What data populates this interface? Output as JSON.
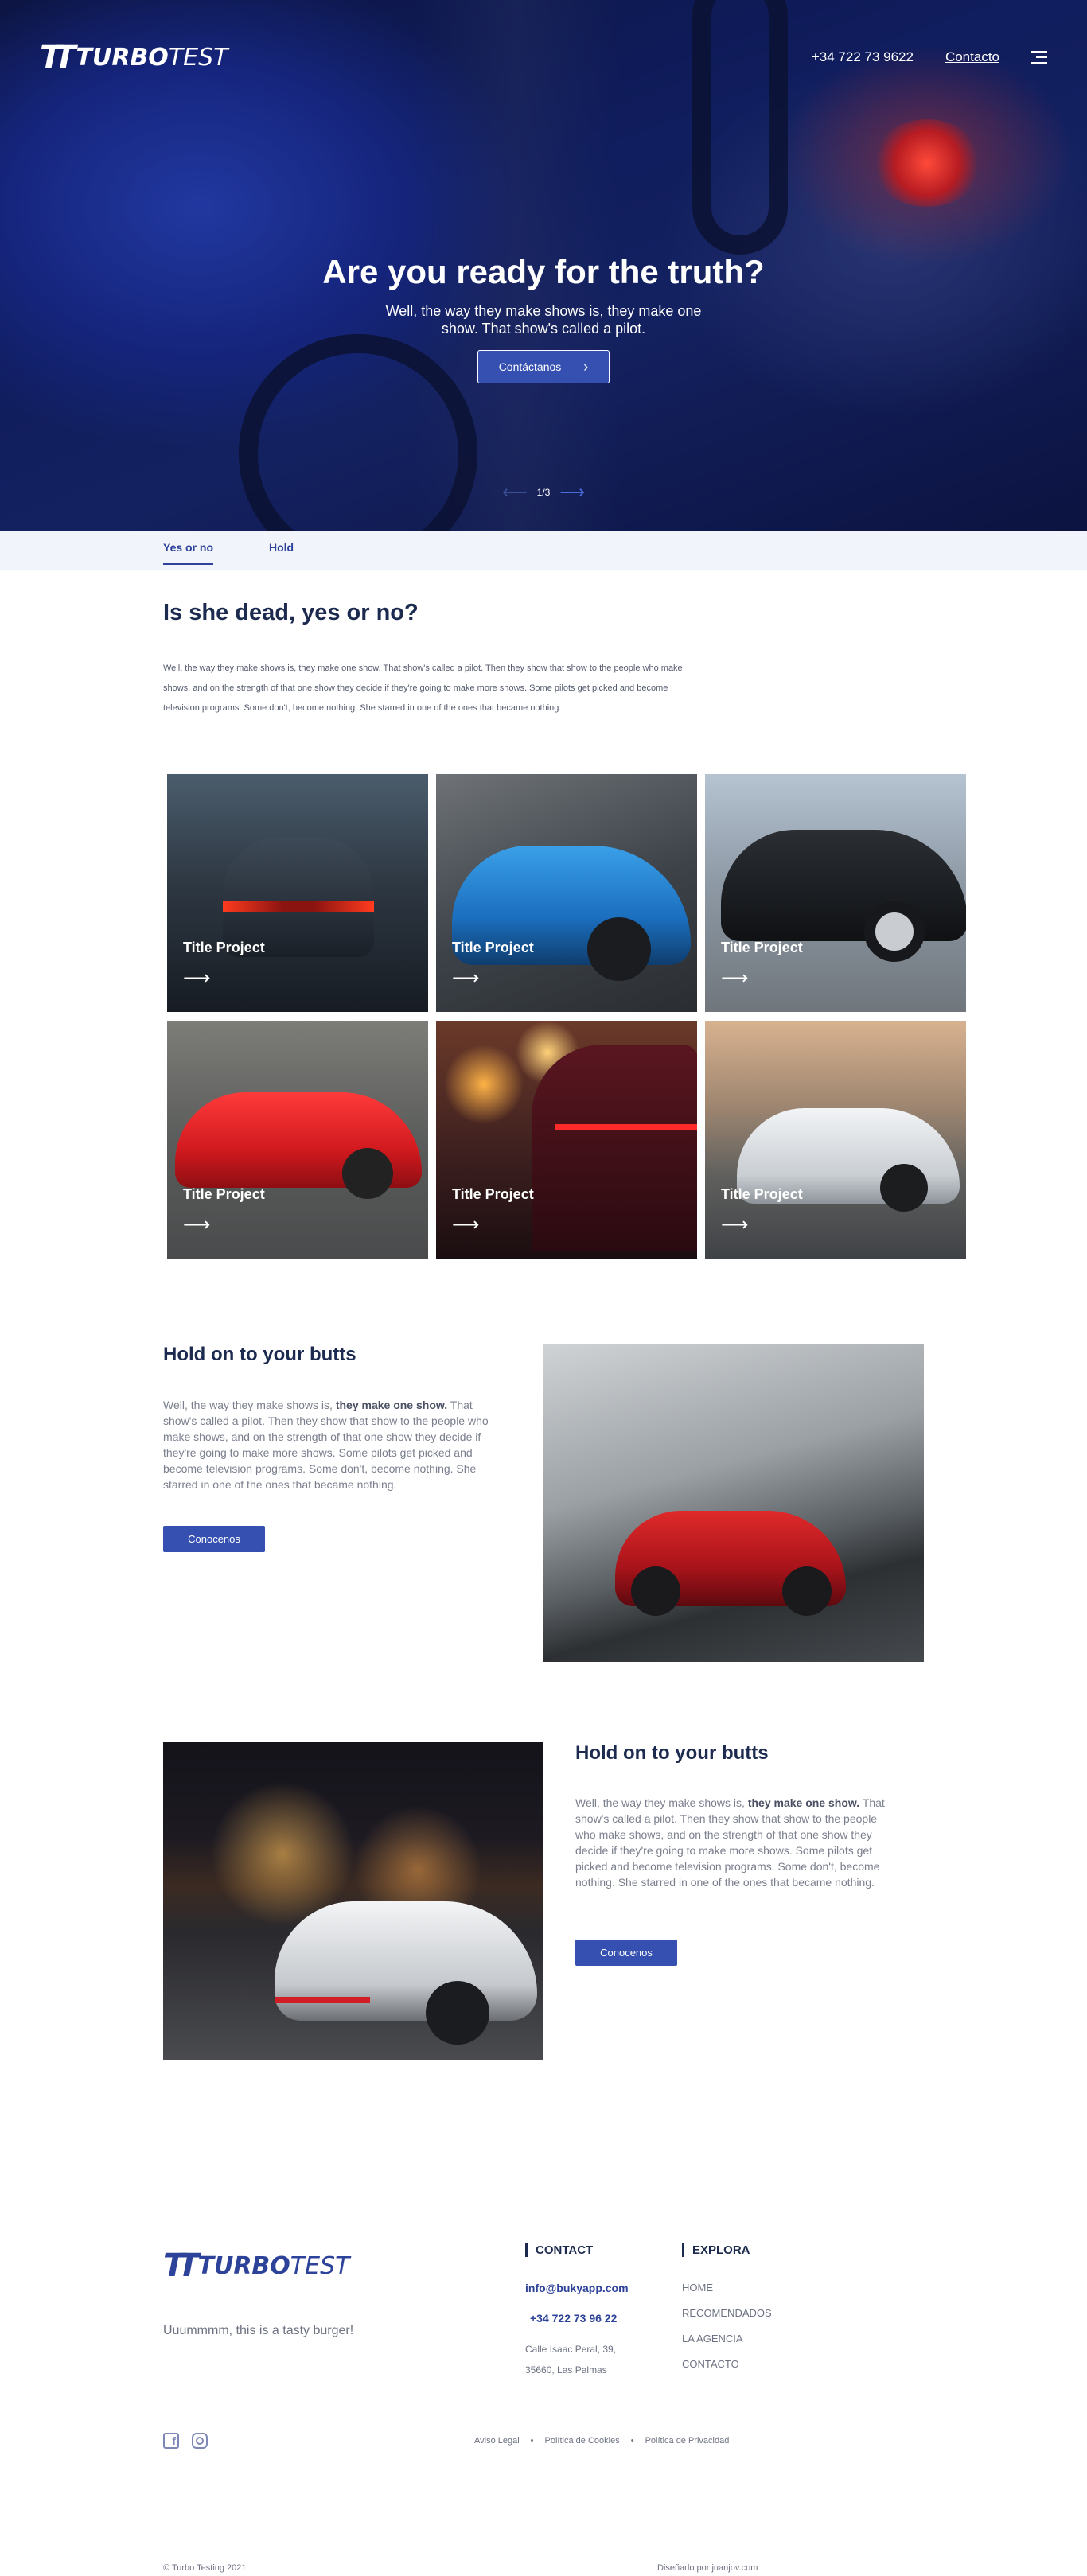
{
  "header": {
    "logo_mark": "TT",
    "logo_bold": "TURBO",
    "logo_light": "TEST",
    "phone": "+34 722 73 9622",
    "contact_label": "Contacto",
    "menu_icon": "hamburger-icon"
  },
  "hero": {
    "title": "Are you ready for the truth?",
    "subtitle": "Well, the way they make shows is, they make one show. That show's called a pilot.",
    "button_label": "Contáctanos",
    "slide_indicator": "1/3"
  },
  "tabs": [
    {
      "label": "Yes or no",
      "active": true
    },
    {
      "label": "Hold",
      "active": false
    }
  ],
  "intro": {
    "title": "Is she dead, yes or no?",
    "text": "Well, the way they make shows is, they make one show. That show's called a pilot. Then they show that show to the people who make shows, and on the strength of that one show they decide if they're going to make more shows. Some pilots get picked and become television programs. Some don't, become nothing. She starred in one of the ones that became nothing."
  },
  "projects": [
    {
      "title": "Title Project"
    },
    {
      "title": "Title Project"
    },
    {
      "title": "Title Project"
    },
    {
      "title": "Title Project"
    },
    {
      "title": "Title Project"
    },
    {
      "title": "Title Project"
    }
  ],
  "feature1": {
    "title": "Hold on to your butts",
    "text_pre": "Well, the way they make shows is, ",
    "text_bold": "they make one show.",
    "text_post": " That show's called a pilot. Then they show that show to the people who make shows, and on the strength of that one show they decide if they're going to make more shows. Some pilots get picked and become television programs. Some don't, become nothing. She starred in one of the ones that became nothing.",
    "button_label": "Conocenos"
  },
  "feature2": {
    "title": "Hold on to your butts",
    "text_pre": "Well, the way they make shows is, ",
    "text_bold": "they make one show.",
    "text_post": " That show's called a pilot. Then they show that show to the people who make shows, and on the strength of that one show they decide if they're going to make more shows. Some pilots get picked and become television programs. Some don't, become nothing. She starred in one of the ones that became nothing.",
    "button_label": "Conocenos"
  },
  "footer": {
    "tagline": "Uuummmm, this is a tasty burger!",
    "contact_heading": "CONTACT",
    "email": "info@bukyapp.com",
    "phone": "+34 722 73 96 22",
    "address_line1": "Calle Isaac Peral, 39,",
    "address_line2": "35660, Las Palmas",
    "explore_heading": "EXPLORA",
    "explore_links": [
      "HOME",
      "RECOMENDADOS",
      "LA AGENCIA",
      "CONTACTO"
    ],
    "legal_links": [
      "Aviso Legal",
      "Política de Cookies",
      "Política de Privacidad"
    ],
    "copyright": "© Turbo Testing 2021",
    "credit": "Diseñado por juanjov.com",
    "social_icons": [
      "facebook-icon",
      "instagram-icon"
    ]
  },
  "colors": {
    "brand_blue": "#3550b0",
    "navy": "#1b2a4e",
    "tabs_bg": "#f2f4fb"
  }
}
